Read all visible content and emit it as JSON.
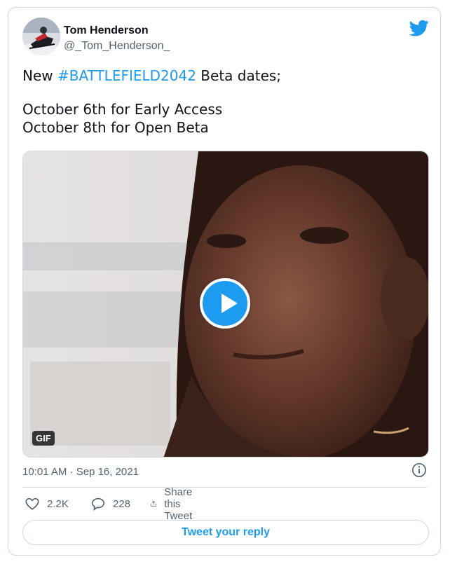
{
  "author": {
    "name": "Tom Henderson",
    "handle": "@_Tom_Henderson_"
  },
  "tweet": {
    "prefix": "New ",
    "hashtag": "#BATTLEFIELD2042",
    "suffix": " Beta dates;",
    "line2": "October 6th for Early Access",
    "line3": "October 8th for Open Beta"
  },
  "media": {
    "badge": "GIF"
  },
  "meta": {
    "timestamp": "10:01 AM · Sep 16, 2021"
  },
  "actions": {
    "likes": "2.2K",
    "replies": "228",
    "share": "Share this Tweet"
  },
  "reply_button": "Tweet your reply",
  "colors": {
    "accent": "#1d9bf0",
    "secondary_text": "#536471",
    "border": "#cfd9de"
  },
  "icons": [
    "twitter-bird-icon",
    "play-icon",
    "info-icon",
    "heart-icon",
    "reply-icon",
    "share-icon"
  ]
}
